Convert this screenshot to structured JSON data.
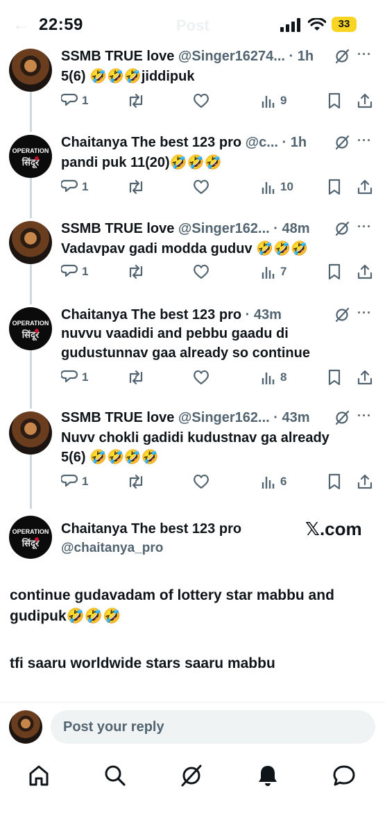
{
  "status_bar": {
    "time": "22:59",
    "battery": "33"
  },
  "header_ghost": {
    "back": "←",
    "title": "Post"
  },
  "tweets": [
    {
      "name": "SSMB TRUE love",
      "handle": "@Singer16274...",
      "time": "· 1h",
      "text": "5(6) 🤣🤣🤣jiddipuk",
      "replies": "1",
      "reposts": "",
      "likes": "",
      "views": "9"
    },
    {
      "name": "Chaitanya The best 123 pro",
      "handle": "@c...",
      "time": "· 1h",
      "text": "pandi puk 11(20)🤣🤣🤣",
      "replies": "1",
      "reposts": "",
      "likes": "",
      "views": "10"
    },
    {
      "name": "SSMB TRUE love",
      "handle": "@Singer162...",
      "time": "· 48m",
      "text": "Vadavpav gadi modda guduv 🤣🤣🤣",
      "replies": "1",
      "reposts": "",
      "likes": "",
      "views": "7"
    },
    {
      "name": "Chaitanya The best 123 pro",
      "handle": "",
      "time": "· 43m",
      "text": "nuvvu vaadidi and pebbu gaadu di gudustunnav gaa already so continue",
      "replies": "1",
      "reposts": "",
      "likes": "",
      "views": "8"
    },
    {
      "name": "SSMB TRUE love",
      "handle": "@Singer162...",
      "time": "· 43m",
      "text": "Nuvv chokli gadidi kudustnav ga already 5(6) 🤣🤣🤣🤣",
      "replies": "1",
      "reposts": "",
      "likes": "",
      "views": "6"
    }
  ],
  "avatar_labels": {
    "op_line1": "OPERATION",
    "op_line2": "सिंदूर"
  },
  "main_tweet": {
    "name": "Chaitanya The best 123 pro",
    "handle": "@chaitanya_pro",
    "watermark": "𝕏.com",
    "text_line1": "continue gudavadam of lottery star mabbu and gudipuk🤣🤣🤣",
    "text_line2": "tfi saaru worldwide stars saaru mabbu"
  },
  "reply_bar": {
    "placeholder": "Post your reply"
  },
  "tabbar": {
    "icons": [
      "home-icon",
      "search-icon",
      "grok-icon",
      "notifications-icon",
      "messages-icon"
    ]
  },
  "colors": {
    "text": "#0f1419",
    "muted": "#536471",
    "thread_line": "#cfd9de",
    "input_bg": "#eff3f4",
    "battery": "#f9d423"
  }
}
